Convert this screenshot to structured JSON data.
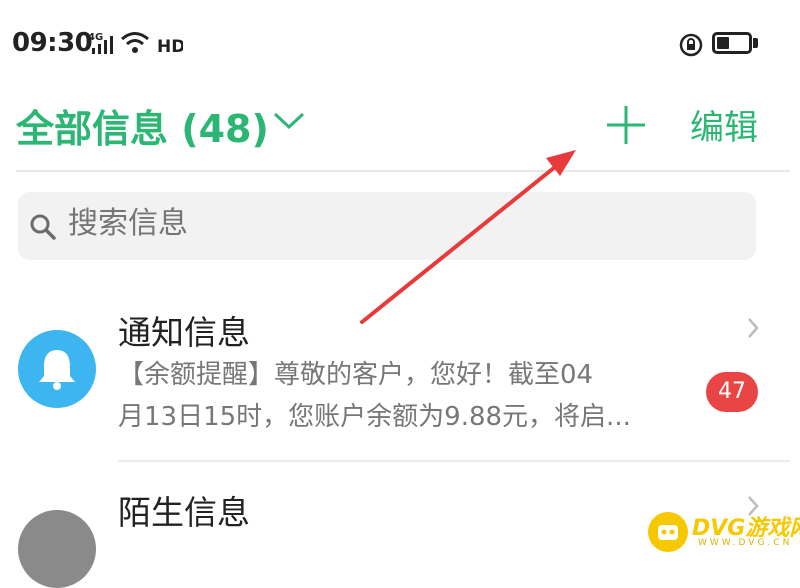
{
  "status_bar": {
    "time": "09:30",
    "network": "4G",
    "hd": "HD"
  },
  "header": {
    "title": "全部信息 (48)",
    "edit_label": "编辑"
  },
  "search": {
    "placeholder": "搜索信息"
  },
  "messages": [
    {
      "title": "通知信息",
      "preview_line1": "【余额提醒】尊敬的客户，您好！截至04",
      "preview_line2": "月13日15时，您账户余额为9.88元，将启...",
      "badge": "47",
      "avatar_color": "#3db5f0"
    },
    {
      "title": "陌生信息",
      "avatar_color": "#8a8a8a"
    }
  ],
  "watermark": {
    "brand": "DVG游戏网",
    "sub": "WWW.DVG.CN"
  },
  "colors": {
    "accent": "#2bb673",
    "badge": "#e94545",
    "annotation_arrow": "#e83a3a"
  }
}
